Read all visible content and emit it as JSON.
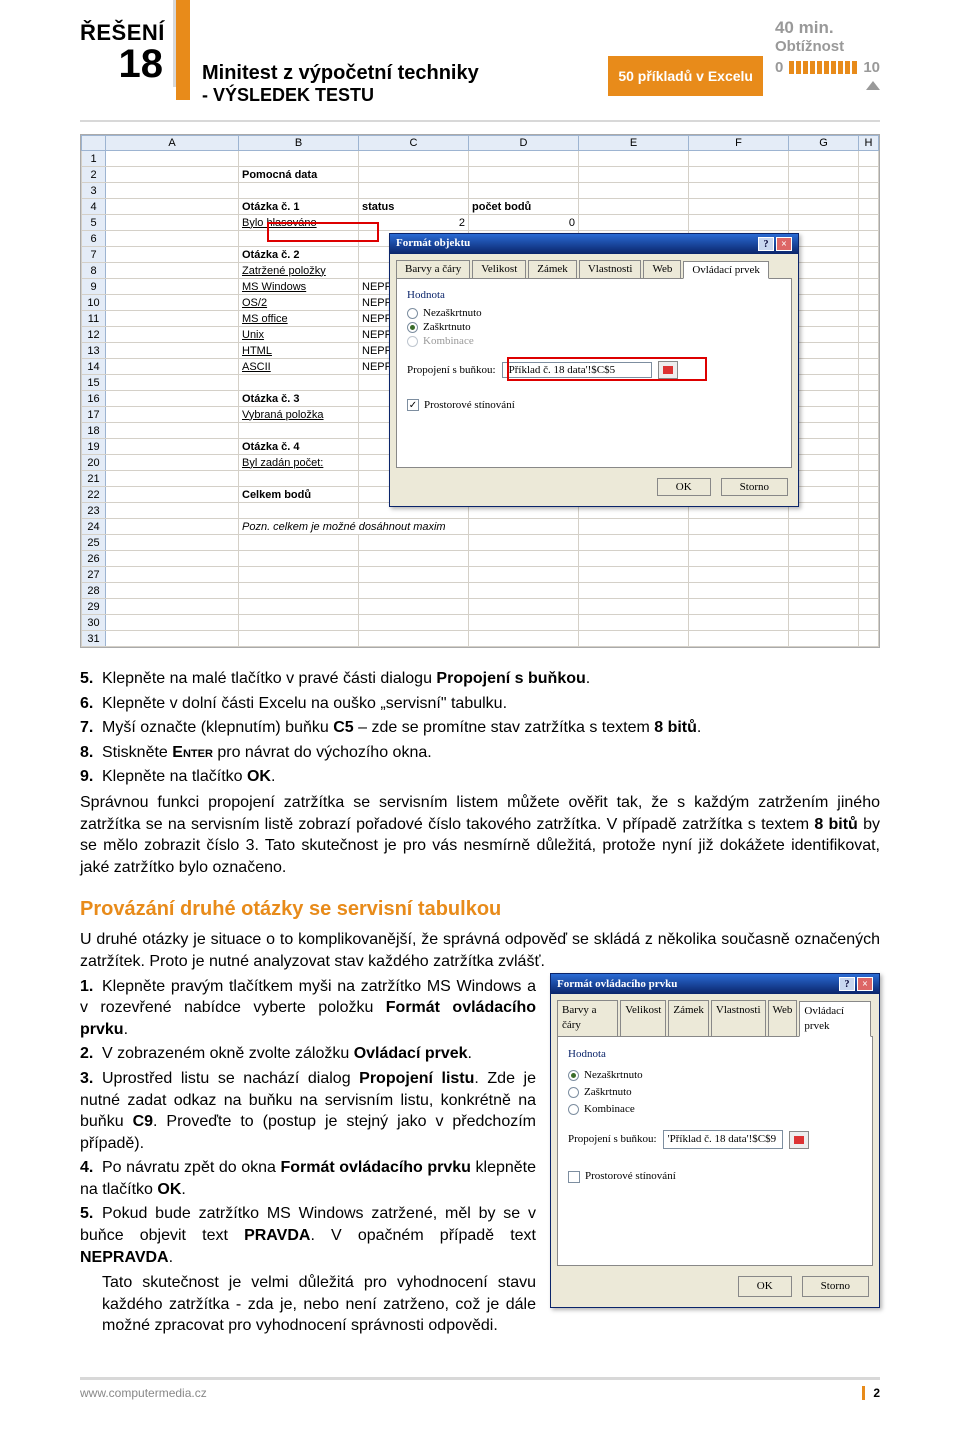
{
  "header": {
    "label": "ŘEŠENÍ",
    "number": "18",
    "title1": "Minitest z výpočetní techniky",
    "title2": "- VÝSLEDEK TESTU",
    "subtitle": "50 příkladů v Excelu",
    "time": "40 min.",
    "diff_label": "Obtížnost",
    "diff_low": "0",
    "diff_high": "10"
  },
  "excel": {
    "cols": [
      "A",
      "B",
      "C",
      "D",
      "E",
      "F",
      "G",
      "H"
    ],
    "rows": {
      "r2": "Pomocná data",
      "r4_b": "Otázka č. 1",
      "r4_c": "status",
      "r4_d": "počet bodů",
      "r5_b": "Bylo hlasováno",
      "r5_c": "2",
      "r5_d": "0",
      "r7": "Otázka č. 2",
      "r8_b": "Zatržené položky",
      "r9_b": "MS Windows",
      "r9_c": "NEPRAVDA",
      "r10_b": "OS/2",
      "r10_c": "NEPRAVDA",
      "r11_b": "MS office",
      "r11_c": "NEPRAVDA",
      "r12_b": "Unix",
      "r12_c": "NEPRAVDA",
      "r13_b": "HTML",
      "r13_c": "NEPRAVDA",
      "r14_b": "ASCII",
      "r14_c": "NEPRAVDA",
      "r16": "Otázka č. 3",
      "r17": "Vybraná položka",
      "r19": "Otázka č. 4",
      "r20": "Byl zadán počet:",
      "r22": "Celkem bodů",
      "r24": "Pozn. celkem je možné dosáhnout maxim"
    }
  },
  "dlg1": {
    "title": "Formát objektu",
    "tabs": [
      "Barvy a čáry",
      "Velikost",
      "Zámek",
      "Vlastnosti",
      "Web",
      "Ovládací prvek"
    ],
    "section": "Hodnota",
    "opt1": "Nezaškrtnuto",
    "opt2": "Zaškrtnuto",
    "opt3": "Kombinace",
    "link_label": "Propojení s buňkou:",
    "link_value": "'Příklad č. 18 data'!$C$5",
    "check_label": "Prostorové stínování",
    "ok": "OK",
    "cancel": "Storno"
  },
  "steps1": {
    "s5_a": "5.",
    "s5_b": "Klepněte na malé tlačítko v pravé části dialogu ",
    "s5_c": "Propojení s buňkou",
    "s5_d": ".",
    "s6_a": "6.",
    "s6_b": "Klepněte v dolní části Excelu na ouško „servisní\" tabulku.",
    "s7_a": "7.",
    "s7_b1": "Myší označte (klepnutím) buňku ",
    "s7_b2": "C5",
    "s7_b3": " – zde se promítne stav zatržítka s textem ",
    "s7_b4": "8 bitů",
    "s7_b5": ".",
    "s8_a": "8.",
    "s8_b": "Stiskněte ",
    "s8_c": "Enter",
    "s8_d": " pro návrat do výchozího okna.",
    "s9_a": "9.",
    "s9_b": "Klepněte na tlačítko ",
    "s9_c": "OK",
    "s9_d": "."
  },
  "para1": "Správnou funkci propojení zatržítka se servisním listem můžete ověřit tak, že s každým zatržením jiného zatržítka se na servisním listě zobrazí pořadové číslo takového zatržítka. V případě zatržítka s textem ",
  "para1b": "8 bitů",
  "para1c": " by se mělo zobrazit číslo 3. Tato skutečnost je pro vás nesmírně důležitá, protože nyní již dokážete identifikovat, jaké zatržítko bylo označeno.",
  "h3": "Provázání druhé otázky se servisní tabulkou",
  "para2": "U druhé otázky je situace o to komplikovanější, že správná odpověď se skládá z několika současně označených zatržítek. Proto je nutné analyzovat stav každého zatržítka zvlášť.",
  "steps2": {
    "s1_a": "1.",
    "s1_b1": "Klepněte pravým tlačítkem myši na zatržítko MS Windows a v rozevřené nabídce vyberte položku ",
    "s1_b2": "Formát ovládacího prvku",
    "s1_b3": ".",
    "s2_a": "2.",
    "s2_b1": "V zobrazeném okně zvolte záložku ",
    "s2_b2": "Ovládací prvek",
    "s2_b3": ".",
    "s3_a": "3.",
    "s3_b1": "Uprostřed listu se nachází dialog ",
    "s3_b2": "Propojení listu",
    "s3_b3": ". Zde je nutné zadat odkaz na buňku na servisním listu, konkrétně na buňku ",
    "s3_b4": "C9",
    "s3_b5": ". Proveďte to (postup je stejný jako v předchozím případě).",
    "s4_a": "4.",
    "s4_b1": "Po návratu zpět do okna ",
    "s4_b2": "Formát ovládacího prvku",
    "s4_b3": " klepněte na tlačítko ",
    "s4_b4": "OK",
    "s4_b5": ".",
    "s5_a": "5.",
    "s5_b1": "Pokud bude zatržítko MS Windows zatržené, měl by se v buňce objevit text ",
    "s5_b2": "PRAVDA",
    "s5_b3": ". V opačném případě text ",
    "s5_b4": "NEPRAVDA",
    "s5_b5": "."
  },
  "para3": "Tato skutečnost je velmi důležitá pro vyhodnocení stavu každého zatržítka - zda je, nebo není zatrženo, což je dále možné zpracovat pro vyhodnocení správnosti odpovědi.",
  "dlg2": {
    "title": "Formát ovládacího prvku",
    "tabs": [
      "Barvy a čáry",
      "Velikost",
      "Zámek",
      "Vlastnosti",
      "Web",
      "Ovládací prvek"
    ],
    "section": "Hodnota",
    "opt1": "Nezaškrtnuto",
    "opt2": "Zaškrtnuto",
    "opt3": "Kombinace",
    "link_label": "Propojení s buňkou:",
    "link_value": "'Příklad č. 18 data'!$C$9",
    "check_label": "Prostorové stínování",
    "ok": "OK",
    "cancel": "Storno"
  },
  "footer": {
    "url": "www.computermedia.cz",
    "page": "2"
  }
}
